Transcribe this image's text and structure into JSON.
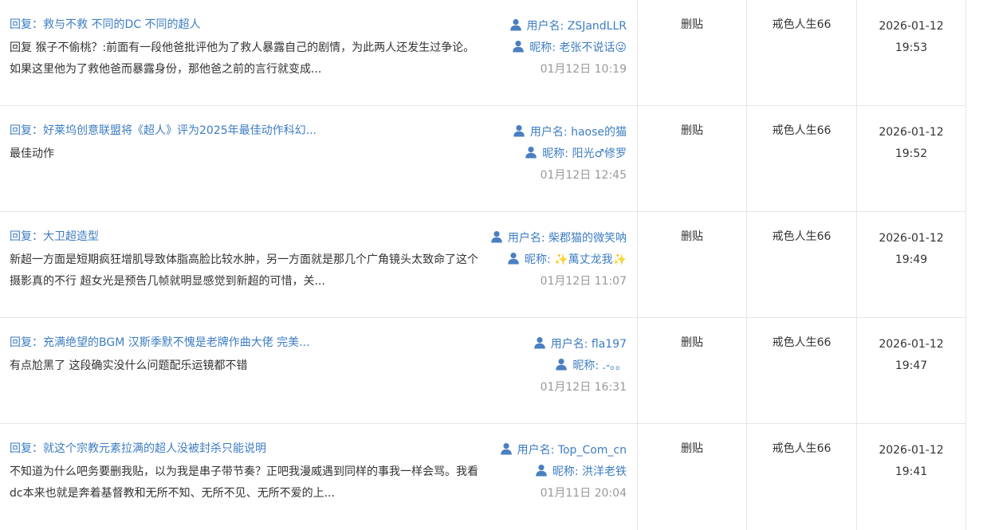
{
  "rows": [
    {
      "title": "回复：救与不救 不同的DC 不同的超人",
      "body": "回复 猴子不偷桃？:前面有一段他爸批评他为了救人暴露自己的剧情，为此两人还发生过争论。如果这里他为了救他爸而暴露身份，那他爸之前的言行就变成...",
      "username": "用户名: ZSJandLLR",
      "nickname": "昵称: 老张不说话😜",
      "date": "01月12日 10:19",
      "action": "删贴",
      "operator": "戒色人生66",
      "op_date": "2026-01-12",
      "op_time": "19:53"
    },
    {
      "title": "回复：好莱坞创意联盟将《超人》评为2025年最佳动作科幻...",
      "body": "最佳动作",
      "username": "用户名: haose的猫",
      "nickname": "昵称: 阳光♂修罗",
      "date": "01月12日 12:45",
      "action": "删贴",
      "operator": "戒色人生66",
      "op_date": "2026-01-12",
      "op_time": "19:52"
    },
    {
      "title": "回复：大卫超造型",
      "body": "新超一方面是短期疯狂增肌导致体脂高脸比较水肿，另一方面就是那几个广角镜头太致命了这个摄影真的不行 超女光是预告几帧就明显感觉到新超的可惜，关...",
      "username": "用户名: 柴郡猫的微笑呐",
      "nickname": "昵称: ✨萬丈龙我✨",
      "date": "01月12日 11:07",
      "action": "删贴",
      "operator": "戒色人生66",
      "op_date": "2026-01-12",
      "op_time": "19:49"
    },
    {
      "title": "回复：充满绝望的BGM 汉斯季默不愧是老牌作曲大佬 完美...",
      "body": "有点尬黑了 这段确实没什么问题配乐运镜都不错",
      "username": "用户名: fla197",
      "nickname": "昵称: .-。。",
      "date": "01月12日 16:31",
      "action": "删贴",
      "operator": "戒色人生66",
      "op_date": "2026-01-12",
      "op_time": "19:47"
    },
    {
      "title": "回复：就这个宗教元素拉满的超人没被封杀只能说明",
      "body": "不知道为什么吧务要删我贴，以为我是串子带节奏？正吧我漫威遇到同样的事我一样会骂。我看dc本来也就是奔着基督教和无所不知、无所不见、无所不爱的上...",
      "username": "用户名: Top_Com_cn",
      "nickname": "昵称: 洪洋老铁",
      "date": "01月11日 20:04",
      "action": "删贴",
      "operator": "戒色人生66",
      "op_date": "2026-01-12",
      "op_time": "19:41"
    }
  ],
  "colors": {
    "link": "#3d7dc2",
    "muted": "#999999",
    "text": "#333333",
    "border": "#e6e6e6"
  },
  "icons": {
    "user": "user-icon"
  }
}
